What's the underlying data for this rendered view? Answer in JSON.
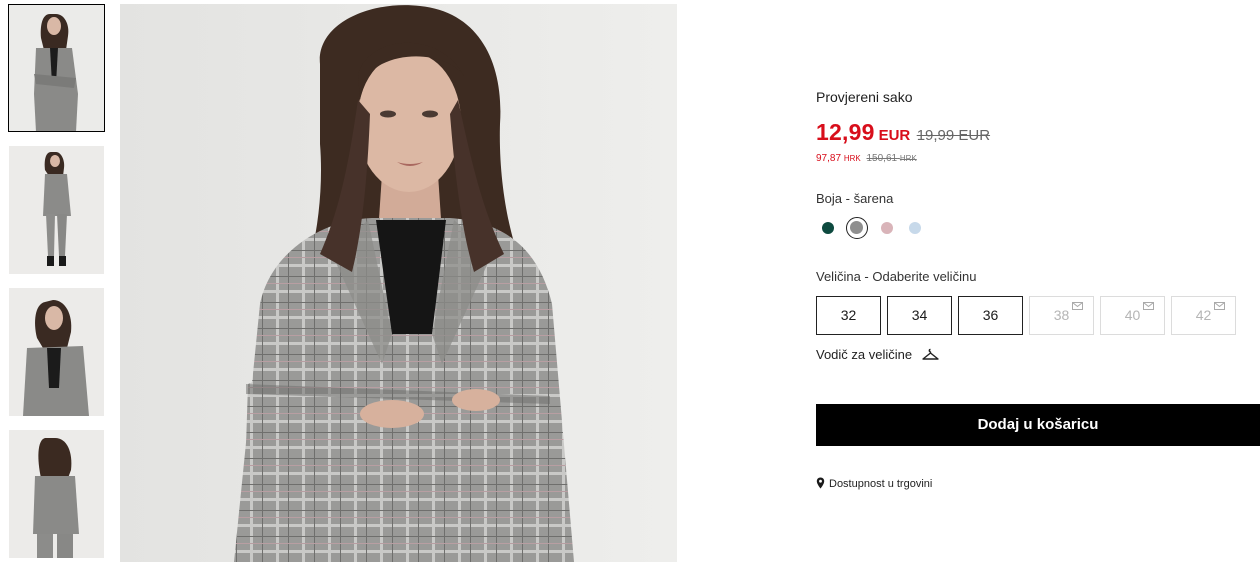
{
  "gallery": {
    "thumbnails": [
      {
        "view": "front-full",
        "selected": true
      },
      {
        "view": "full-body",
        "selected": false
      },
      {
        "view": "three-quarter",
        "selected": false
      },
      {
        "view": "back",
        "selected": false
      }
    ],
    "main_view": "front-closeup"
  },
  "product": {
    "name": "Provjereni sako",
    "price": {
      "current": "12,99",
      "currency": "EUR",
      "old": "19,99 EUR"
    },
    "price_secondary": {
      "current": "97,87",
      "current_currency": "HRK",
      "old": "150,61",
      "old_currency": "HRK"
    },
    "color": {
      "label": "Boja - šarena",
      "swatches": [
        {
          "color": "#0d4a3f",
          "selected": false
        },
        {
          "color": "#8f8f8f",
          "selected": true
        },
        {
          "color": "#d9b4b9",
          "selected": false
        },
        {
          "color": "#c7d9ea",
          "selected": false
        }
      ]
    },
    "size": {
      "label": "Veličina - Odaberite veličinu",
      "options": [
        {
          "label": "32",
          "available": true
        },
        {
          "label": "34",
          "available": true
        },
        {
          "label": "36",
          "available": true
        },
        {
          "label": "38",
          "available": false
        },
        {
          "label": "40",
          "available": false
        },
        {
          "label": "42",
          "available": false
        }
      ],
      "guide_label": "Vodič za veličine"
    },
    "add_to_cart_label": "Dodaj u košaricu",
    "availability_label": "Dostupnost u trgovini",
    "accent_color": "#d80e1b"
  }
}
